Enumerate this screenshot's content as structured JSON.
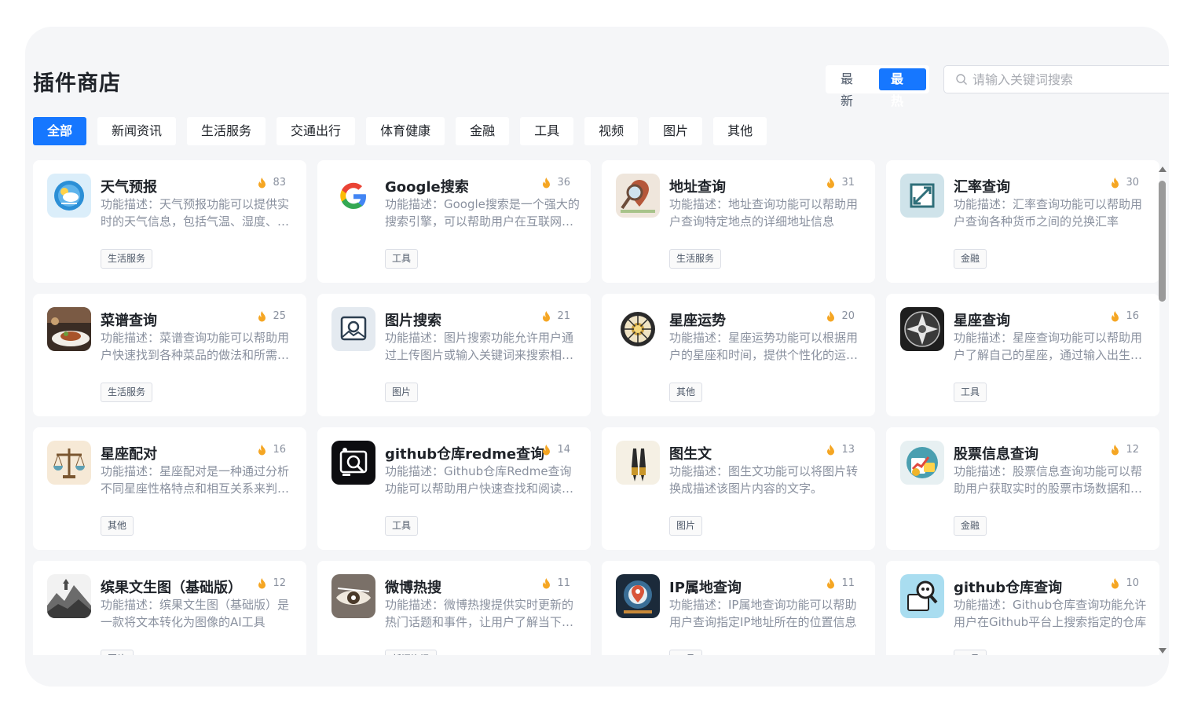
{
  "header": {
    "title": "插件商店",
    "sort": {
      "latest": "最新",
      "hottest": "最热",
      "active": "hottest"
    },
    "search_placeholder": "请输入关键词搜索"
  },
  "tabs": [
    "全部",
    "新闻资讯",
    "生活服务",
    "交通出行",
    "体育健康",
    "金融",
    "工具",
    "视频",
    "图片",
    "其他"
  ],
  "active_tab": 0,
  "colors": {
    "accent": "#1677ff",
    "flame": "#f5a623"
  },
  "plugins": [
    {
      "name": "天气预报",
      "hot": "83",
      "desc": "功能描述：天气预报功能可以提供实时的天气信息，包括气温、湿度、风力等数据",
      "tag": "生活服务",
      "icon": "weather-icon"
    },
    {
      "name": "Google搜索",
      "hot": "36",
      "desc": "功能描述：Google搜索是一个强大的搜索引擎，可以帮助用户在互联网上快速找到所需信息",
      "tag": "工具",
      "icon": "google-icon"
    },
    {
      "name": "地址查询",
      "hot": "31",
      "desc": "功能描述：地址查询功能可以帮助用户查询特定地点的详细地址信息",
      "tag": "生活服务",
      "icon": "map-pin-icon"
    },
    {
      "name": "汇率查询",
      "hot": "30",
      "desc": "功能描述：汇率查询功能可以帮助用户查询各种货币之间的兑换汇率",
      "tag": "金融",
      "icon": "exchange-icon"
    },
    {
      "name": "菜谱查询",
      "hot": "25",
      "desc": "功能描述：菜谱查询功能可以帮助用户快速找到各种菜品的做法和所需食材",
      "tag": "生活服务",
      "icon": "recipe-icon"
    },
    {
      "name": "图片搜索",
      "hot": "21",
      "desc": "功能描述：图片搜索功能允许用户通过上传图片或输入关键词来搜索相关图片",
      "tag": "图片",
      "icon": "image-search-icon"
    },
    {
      "name": "星座运势",
      "hot": "20",
      "desc": "功能描述：星座运势功能可以根据用户的星座和时间，提供个性化的运势分析",
      "tag": "其他",
      "icon": "zodiac-wheel-icon"
    },
    {
      "name": "星座查询",
      "hot": "16",
      "desc": "功能描述：星座查询功能可以帮助用户了解自己的星座，通过输入出生日期即可查询",
      "tag": "工具",
      "icon": "compass-star-icon"
    },
    {
      "name": "星座配对",
      "hot": "16",
      "desc": "功能描述：星座配对是一种通过分析不同星座性格特点和相互关系来判断匹配程度的功能",
      "tag": "其他",
      "icon": "scales-icon"
    },
    {
      "name": "github仓库redme查询",
      "hot": "14",
      "desc": "功能描述：Github仓库Redme查询功能可以帮助用户快速查找和阅读仓库说明文档",
      "tag": "工具",
      "icon": "github-readme-icon"
    },
    {
      "name": "图生文",
      "hot": "13",
      "desc": "功能描述：图生文功能可以将图片转换成描述该图片内容的文字。",
      "tag": "图片",
      "icon": "brush-icon"
    },
    {
      "name": "股票信息查询",
      "hot": "12",
      "desc": "功能描述：股票信息查询功能可以帮助用户获取实时的股票市场数据和行情信息",
      "tag": "金融",
      "icon": "stock-chart-icon"
    },
    {
      "name": "缤果文生图（基础版）",
      "hot": "12",
      "desc": "功能描述：缤果文生图（基础版）是一款将文本转化为图像的AI工具",
      "tag": "图片",
      "icon": "landscape-icon"
    },
    {
      "name": "微博热搜",
      "hot": "11",
      "desc": "功能描述：微博热搜提供实时更新的热门话题和事件，让用户了解当下热点",
      "tag": "新闻资讯",
      "icon": "eye-icon"
    },
    {
      "name": "IP属地查询",
      "hot": "11",
      "desc": "功能描述：IP属地查询功能可以帮助用户查询指定IP地址所在的位置信息",
      "tag": "工具",
      "icon": "ip-location-icon"
    },
    {
      "name": "github仓库查询",
      "hot": "10",
      "desc": "功能描述：Github仓库查询功能允许用户在Github平台上搜索指定的仓库",
      "tag": "工具",
      "icon": "github-search-icon"
    }
  ]
}
